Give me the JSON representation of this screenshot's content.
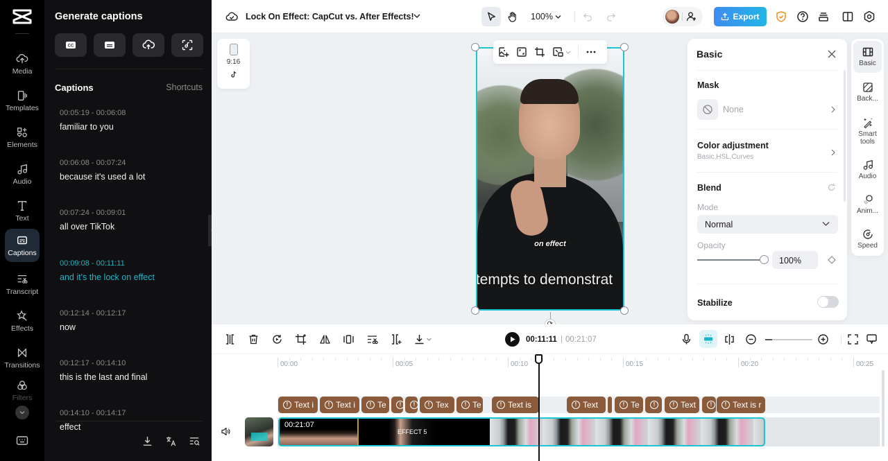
{
  "app": {
    "project_title": "Lock On Effect: CapCut vs. After Effects!",
    "zoom_level": "100%",
    "export_label": "Export"
  },
  "left_nav": {
    "items": [
      {
        "label": "Media",
        "icon": "cloud-upload-icon"
      },
      {
        "label": "Templates",
        "icon": "templates-icon"
      },
      {
        "label": "Elements",
        "icon": "elements-icon"
      },
      {
        "label": "Audio",
        "icon": "music-note-icon"
      },
      {
        "label": "Text",
        "icon": "text-icon"
      },
      {
        "label": "Captions",
        "icon": "captions-icon",
        "active": true
      },
      {
        "label": "Transcript",
        "icon": "transcript-icon"
      },
      {
        "label": "Effects",
        "icon": "effects-icon"
      },
      {
        "label": "Transitions",
        "icon": "transitions-icon"
      },
      {
        "label": "Filters",
        "icon": "filters-icon"
      }
    ]
  },
  "captions_panel": {
    "title": "Generate captions",
    "tools": [
      "auto-captions-icon",
      "subtitle-icon",
      "upload-captions-icon",
      "scan-lyrics-icon"
    ],
    "section_title": "Captions",
    "shortcuts_label": "Shortcuts",
    "items": [
      {
        "time": "00:05:19 - 00:06:08",
        "text": "familiar to you"
      },
      {
        "time": "00:06:08 - 00:07:24",
        "text": "because it's used a lot"
      },
      {
        "time": "00:07:24 - 00:09:01",
        "text": "all over TikTok"
      },
      {
        "time": "00:09:08 - 00:11:11",
        "text": "and it's the lock on effect",
        "active": true
      },
      {
        "time": "00:12:14 - 00:12:17",
        "text": "now"
      },
      {
        "time": "00:12:17 - 00:14:10",
        "text": "this is the last and final"
      },
      {
        "time": "00:14:10 - 00:14:17",
        "text": "effect"
      }
    ]
  },
  "canvas": {
    "aspect_ratio": "9:16",
    "platform_icon": "tiktok-icon",
    "overlay_caption": "on effect",
    "subtitle_caption": "ttempts to demonstrat"
  },
  "properties": {
    "title": "Basic",
    "mask_label": "Mask",
    "mask_value": "None",
    "color_adjust_label": "Color adjustment",
    "color_adjust_sub": "Basic,HSL,Curves",
    "blend_label": "Blend",
    "mode_label": "Mode",
    "mode_value": "Normal",
    "opacity_label": "Opacity",
    "opacity_value": "100%",
    "opacity_fraction": 1.0,
    "stabilize_label": "Stabilize",
    "stabilize_on": false
  },
  "right_tabs": [
    {
      "label": "Basic",
      "active": true
    },
    {
      "label": "Back..."
    },
    {
      "label": "Smart tools"
    },
    {
      "label": "Audio"
    },
    {
      "label": "Anim..."
    },
    {
      "label": "Speed"
    }
  ],
  "timeline": {
    "current_time": "00:11:11",
    "separator": "|",
    "duration": "00:21:07",
    "ruler_labels": [
      "00:00",
      "00:05",
      "00:10",
      "00:15",
      "00:20",
      "00:25"
    ],
    "text_chips": [
      "Text i",
      "Text i",
      "Te",
      "",
      "",
      "Tex",
      "Te",
      "Text is",
      "Text",
      "",
      "Te",
      "",
      "Text",
      "",
      "Text is r"
    ],
    "clip_duration": "00:21:07",
    "clip_effect_label": "EFFECT 5"
  }
}
